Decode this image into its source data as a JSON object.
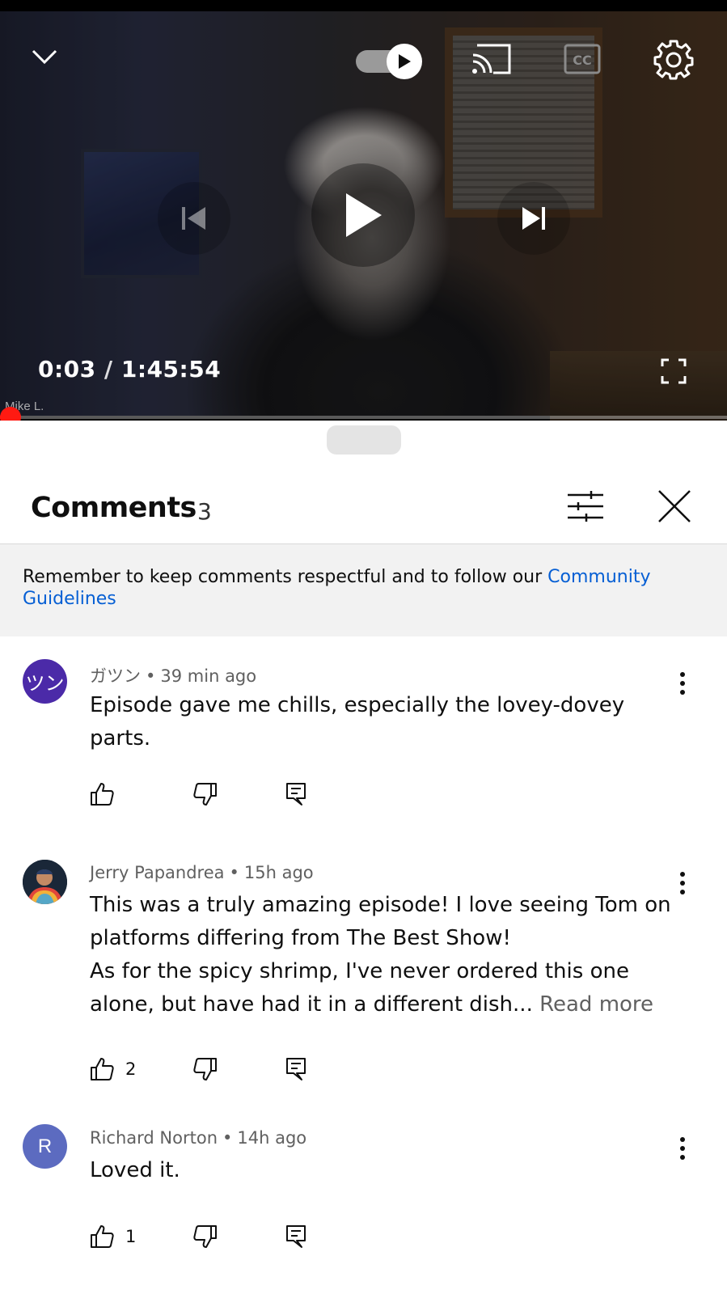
{
  "player": {
    "current_time": "0:03",
    "separator": " / ",
    "duration": "1:45:54",
    "speaker_label": "Mike L.",
    "progress_fraction": 0.0005,
    "autoplay_on": true,
    "icons": [
      "chevron-down-icon",
      "autoplay-toggle-icon",
      "cast-icon",
      "captions-icon",
      "settings-gear-icon",
      "previous-icon",
      "play-icon",
      "next-icon",
      "fullscreen-icon"
    ],
    "accent_color": "#ff0000"
  },
  "comments_panel": {
    "title": "Comments",
    "count": "3",
    "notice_text": "Remember to keep comments respectful and to follow our ",
    "notice_link": "Community Guidelines",
    "link_color": "#065fd4"
  },
  "comments": [
    {
      "author": "ガツン",
      "time": "39 min ago",
      "avatar_text": "ツン",
      "avatar_color": "#4b2aa8",
      "body": "Episode gave me chills, especially the lovey-dovey parts.",
      "likes": ""
    },
    {
      "author": "Jerry Papandrea",
      "time": "15h ago",
      "avatar_text": "",
      "avatar_color": "#1e2a3a",
      "body_line1": "This was a truly amazing episode! I love seeing Tom on platforms differing from The Best Show!",
      "body_line2": "As for the spicy shrimp, I've never ordered this one alone, but have had it in a different dish...",
      "read_more": "Read more",
      "likes": "2"
    },
    {
      "author": "Richard Norton",
      "time": "14h ago",
      "avatar_text": "R",
      "avatar_color": "#5c6bc0",
      "body": "Loved it.",
      "likes": "1"
    }
  ]
}
